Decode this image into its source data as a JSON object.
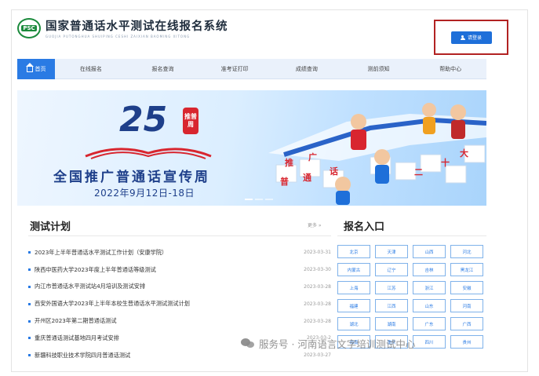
{
  "header": {
    "logo_badge": "PSC",
    "title": "国家普通话水平测试在线报名系统",
    "subtitle": "GUOJIA PUTONGHUA SHUIPING CESHI ZAIXIAN BAOMING XITONG",
    "login_label": "请登录"
  },
  "nav": {
    "items": [
      {
        "label": "首页"
      },
      {
        "label": "在线报名"
      },
      {
        "label": "报名查询"
      },
      {
        "label": "准考证打印"
      },
      {
        "label": "成绩查询"
      },
      {
        "label": "测前须知"
      },
      {
        "label": "帮助中心"
      }
    ]
  },
  "banner": {
    "number": "25",
    "badge_top": "推普",
    "badge_bottom": "周",
    "headline": "全国推广普通话宣传周",
    "date": "2022年9月12日-18日",
    "tiles": [
      "推",
      "广",
      "普",
      "通",
      "话",
      "二",
      "十",
      "大"
    ]
  },
  "plan": {
    "title": "测试计划",
    "more": "更多 »",
    "items": [
      {
        "title": "2023年上半年普通话水平测试工作计划（安康学院）",
        "date": "2023-03-31"
      },
      {
        "title": "陕西中医药大学2023年度上半年普通话等级测试",
        "date": "2023-03-30"
      },
      {
        "title": "内江市普通话水平测试站4月培训及测试安排",
        "date": "2023-03-28"
      },
      {
        "title": "西安外国语大学2023年上半年本校生普通话水平测试测试计划",
        "date": "2023-03-28"
      },
      {
        "title": "开州区2023年第二期普通话测试",
        "date": "2023-03-28"
      },
      {
        "title": "重庆普通话测试基地四月考试安排",
        "date": "2023-03-2"
      },
      {
        "title": "新疆科技职业技术学院四月普通话测试",
        "date": "2023-03-27"
      }
    ]
  },
  "registration": {
    "title": "报名入口",
    "regions": [
      "北京",
      "天津",
      "山西",
      "河北",
      "内蒙古",
      "辽宁",
      "吉林",
      "黑龙江",
      "上海",
      "江苏",
      "浙江",
      "安徽",
      "福建",
      "江西",
      "山东",
      "河南",
      "湖北",
      "湖南",
      "广东",
      "广西",
      "海南",
      "重庆",
      "四川",
      "贵州"
    ]
  },
  "watermark": {
    "text": "服务号 · 河南语言文字培训测试中心"
  },
  "colors": {
    "primary": "#2a7be4",
    "login_highlight": "#b22222",
    "logo_green": "#1b8a3c",
    "banner_navy": "#1e3f8a",
    "badge_red": "#d8262f"
  }
}
